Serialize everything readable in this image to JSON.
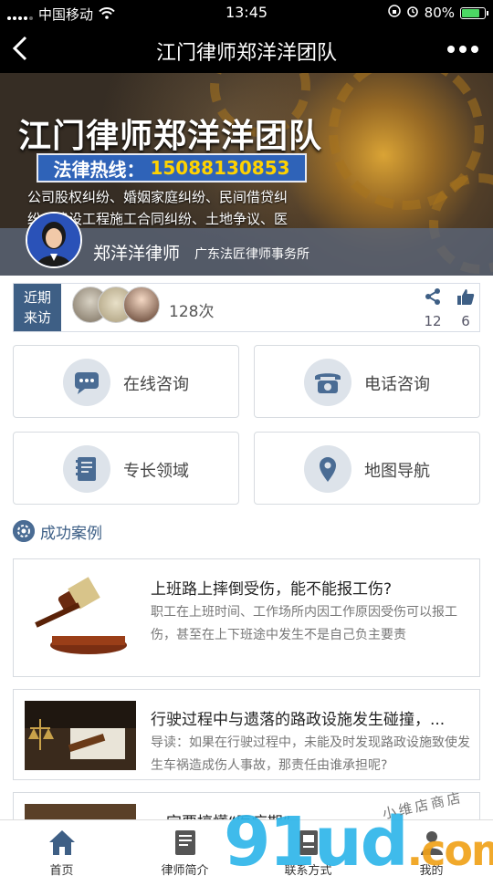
{
  "status": {
    "carrier": "中国移动",
    "time": "13:45",
    "battery": "80%",
    "battery_level": 0.8
  },
  "nav": {
    "title": "江门律师郑洋洋团队"
  },
  "banner": {
    "title": "江门律师郑洋洋团队",
    "hotline_label": "法律热线：",
    "hotline_number": "15088130853",
    "business_line1": "公司股权纠纷、婚姻家庭纠纷、民间借贷纠",
    "business_line2": "纷、建设工程施工合同纠纷、土地争议、医",
    "lawyer_name": "郑洋洋律师",
    "lawyer_firm": "广东法匠律师事务所"
  },
  "visits": {
    "tag": "近期来访",
    "count": "128次",
    "shares": "12",
    "likes": "6"
  },
  "actions": [
    {
      "label": "在线咨询",
      "icon": "chat-bubble-icon"
    },
    {
      "label": "电话咨询",
      "icon": "telephone-icon"
    },
    {
      "label": "专长领域",
      "icon": "notebook-icon"
    },
    {
      "label": "地图导航",
      "icon": "map-pin-icon"
    }
  ],
  "section": {
    "title": "成功案例"
  },
  "cases": [
    {
      "title": "上班路上摔倒受伤，能不能报工伤?",
      "desc": "职工在上班时间、工作场所内因工作原因受伤可以报工伤，甚至在上下班途中发生不是自己负主要责"
    },
    {
      "title": "行驶过程中与遗落的路政设施发生碰撞，...",
      "desc": "导读：如果在行驶过程中，未能及时发现路政设施致使发生车祸造成伤人事故，那责任由谁承担呢?"
    },
    {
      "title": "一定要搞懂“医疗期”",
      "desc": ""
    }
  ],
  "tabs": [
    {
      "label": "首页",
      "icon": "home-icon"
    },
    {
      "label": "律师简介",
      "icon": "profile-card-icon"
    },
    {
      "label": "联系方式",
      "icon": "contact-icon"
    },
    {
      "label": "我的",
      "icon": "person-icon"
    }
  ],
  "watermark": {
    "main": "91ud",
    "suffix": ".com",
    "handwriting": "小维店商店"
  },
  "colors": {
    "accent": "#3e5f85",
    "hotline_bg": "#2f63b8",
    "hotline_number": "#ffd200",
    "tab_active": "#3e5f85"
  }
}
